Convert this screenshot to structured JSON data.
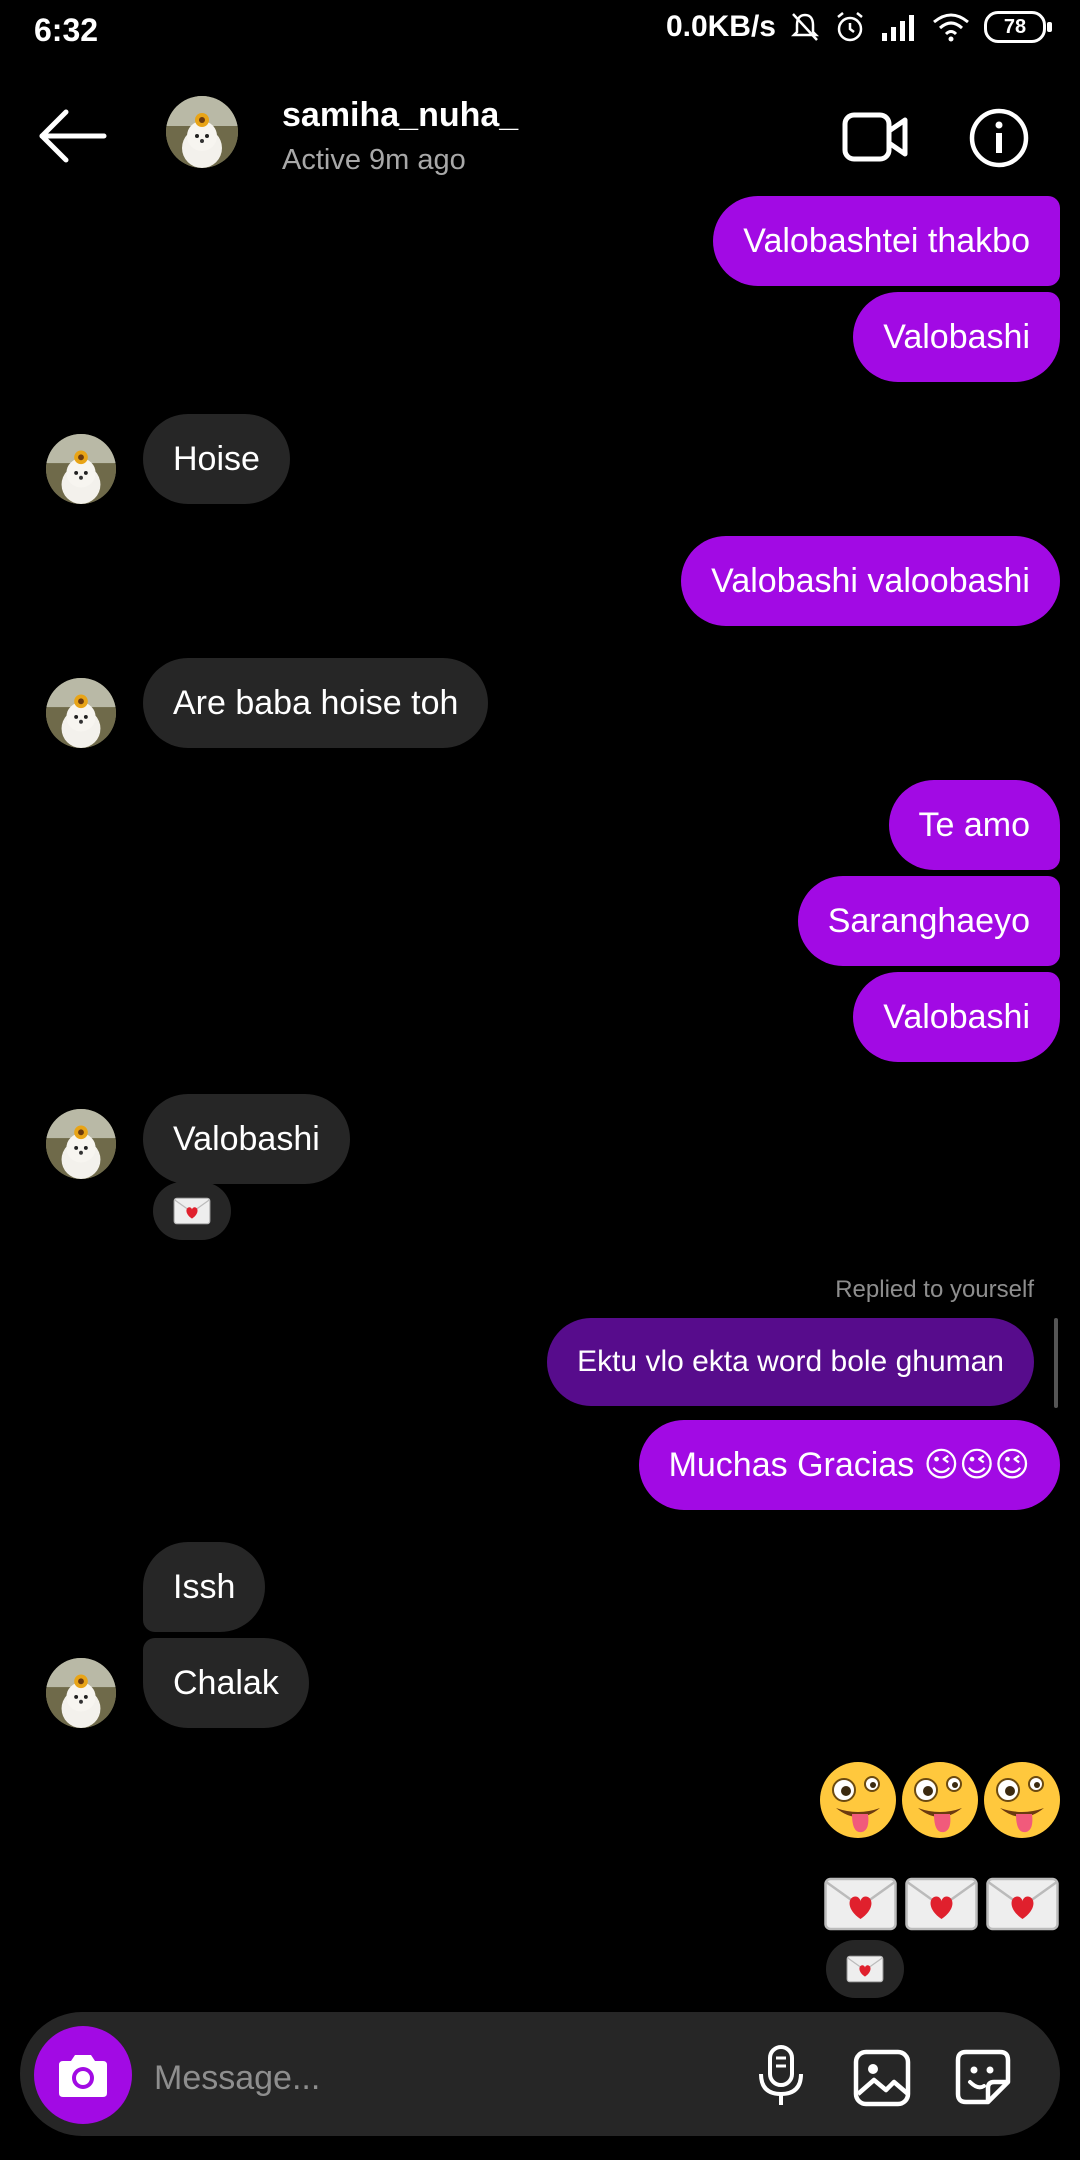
{
  "status_bar": {
    "time": "6:32",
    "network_speed": "0.0KB/s",
    "battery": "78",
    "icons": [
      "bell-muted-icon",
      "alarm-icon",
      "signal-icon",
      "wifi-icon",
      "battery-icon"
    ]
  },
  "header": {
    "username": "samiha_nuha_",
    "status": "Active 9m ago",
    "icons": [
      "back-arrow-icon",
      "video-call-icon",
      "info-icon"
    ]
  },
  "messages": {
    "m1": "Valobashtei thakbo",
    "m2": "Valobashi",
    "m3": "Hoise",
    "m4": "Valobashi valoobashi",
    "m5": "Are baba hoise toh",
    "m6": "Te amo",
    "m7": "Saranghaeyo",
    "m8": "Valobashi",
    "m9": "Valobashi",
    "replied_label": "Replied to yourself",
    "m10": "Ektu vlo ekta word bole ghuman",
    "m11": "Muchas Gracias 😉😉😉",
    "m12": "Issh",
    "m13": "Chalak",
    "emoji_row": "🤪🤪🤪"
  },
  "reactions": {
    "r1": "love-letter-icon",
    "r2": "love-letter-icon"
  },
  "composer": {
    "placeholder": "Message...",
    "icons": [
      "camera-icon",
      "microphone-icon",
      "gallery-icon",
      "sticker-icon"
    ]
  },
  "colors": {
    "outgoing_bubble": "#a20ae4",
    "reply_bubble": "#570c8c",
    "incoming_bubble": "#262626",
    "background": "#000000"
  }
}
